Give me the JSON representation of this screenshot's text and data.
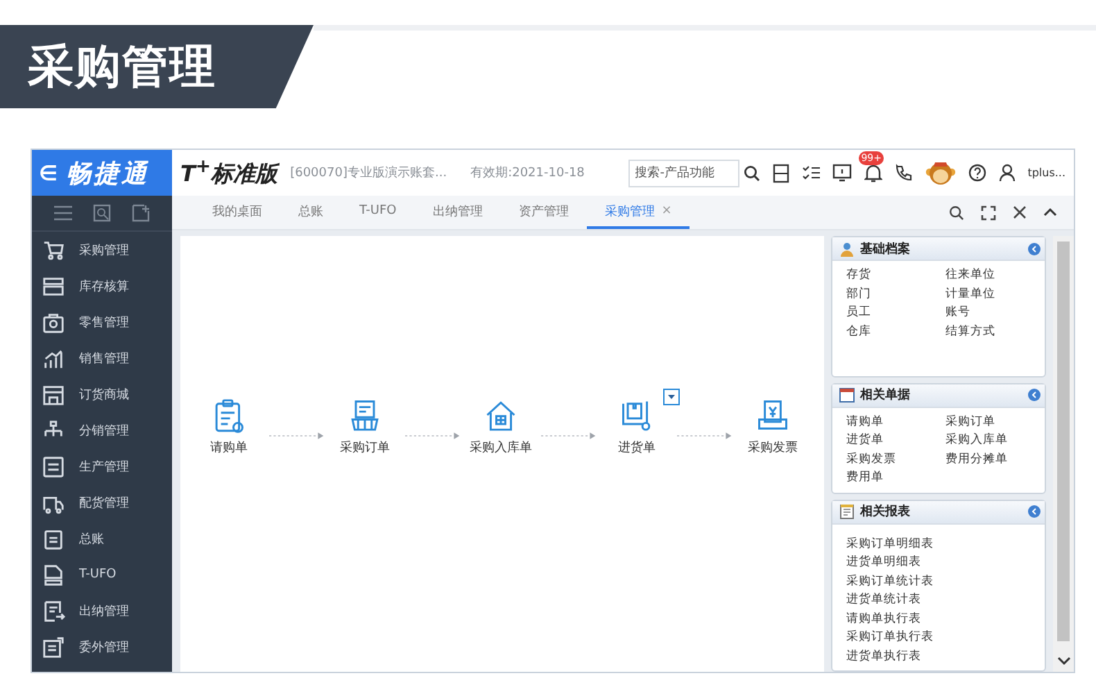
{
  "banner": {
    "title": "采购管理"
  },
  "app": {
    "brand_arrow": "∈",
    "brand": "畅捷通",
    "product": "T$^{+}$标准版",
    "account": "[600070]专业版演示账套...",
    "validity": "有效期:2021-10-18",
    "search": {
      "placeholder": "搜索-产品功能"
    },
    "badge": "99+",
    "user": "tplus..."
  },
  "sidebar": {
    "items": [
      {
        "label": "采购管理"
      },
      {
        "label": "库存核算"
      },
      {
        "label": "零售管理"
      },
      {
        "label": "销售管理"
      },
      {
        "label": "订货商城"
      },
      {
        "label": "分销管理"
      },
      {
        "label": "生产管理"
      },
      {
        "label": "配货管理"
      },
      {
        "label": "总账"
      },
      {
        "label": "T-UFO"
      },
      {
        "label": "出纳管理"
      },
      {
        "label": "委外管理"
      }
    ]
  },
  "tabs": [
    {
      "label": "我的桌面",
      "selected": false
    },
    {
      "label": "总账",
      "selected": false
    },
    {
      "label": "T-UFO",
      "selected": false
    },
    {
      "label": "出纳管理",
      "selected": false
    },
    {
      "label": "资产管理",
      "selected": false
    },
    {
      "label": "采购管理",
      "selected": true,
      "close": "×"
    }
  ],
  "flow": {
    "steps": [
      {
        "label": "请购单",
        "has_menu": false
      },
      {
        "label": "采购订单",
        "has_menu": false
      },
      {
        "label": "采购入库单",
        "has_menu": false
      },
      {
        "label": "进货单",
        "has_menu": true
      },
      {
        "label": "采购发票",
        "has_menu": false
      }
    ]
  },
  "panels": [
    {
      "title": "基础档案",
      "items": [
        "存货",
        "往来单位",
        "部门",
        "计量单位",
        "员工",
        "账号",
        "仓库",
        "结算方式"
      ]
    },
    {
      "title": "相关单据",
      "items": [
        "请购单",
        "采购订单",
        "进货单",
        "采购入库单",
        "采购发票",
        "费用分摊单",
        "费用单"
      ]
    },
    {
      "title": "相关报表",
      "items": [
        "采购订单明细表",
        "进货单明细表",
        "采购订单统计表",
        "进货单统计表",
        "请购单执行表",
        "采购订单执行表",
        "进货单执行表"
      ]
    }
  ]
}
